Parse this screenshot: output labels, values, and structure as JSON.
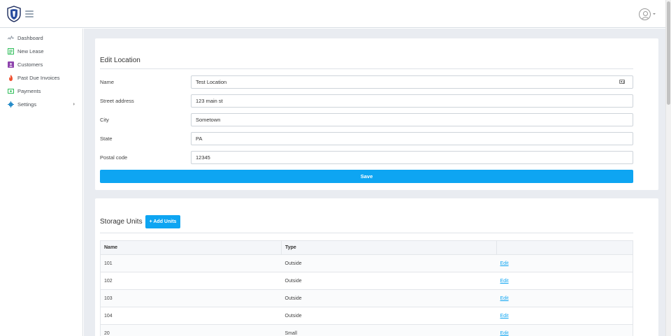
{
  "nav": {
    "items": [
      {
        "label": "Dashboard",
        "icon": "activity-icon",
        "color": "#8a94a0"
      },
      {
        "label": "New Lease",
        "icon": "document-icon",
        "color": "#2ebd59"
      },
      {
        "label": "Customers",
        "icon": "contact-card-icon",
        "color": "#8e44ad"
      },
      {
        "label": "Past Due Invoices",
        "icon": "flame-icon",
        "color": "#f0502f"
      },
      {
        "label": "Payments",
        "icon": "money-icon",
        "color": "#2ebd59"
      },
      {
        "label": "Settings",
        "icon": "gear-icon",
        "color": "#1e88c7"
      }
    ]
  },
  "edit_location": {
    "title": "Edit Location",
    "fields": [
      {
        "label": "Name",
        "value": "Test Location"
      },
      {
        "label": "Street address",
        "value": "123 main st"
      },
      {
        "label": "City",
        "value": "Sometown"
      },
      {
        "label": "State",
        "value": "PA"
      },
      {
        "label": "Postal code",
        "value": "12345"
      }
    ],
    "save_label": "Save"
  },
  "storage_units": {
    "title": "Storage Units",
    "add_label": "+ Add Units",
    "columns": [
      "Name",
      "Type",
      ""
    ],
    "rows": [
      {
        "name": "101",
        "type": "Outside",
        "action": "Edit"
      },
      {
        "name": "102",
        "type": "Outside",
        "action": "Edit"
      },
      {
        "name": "103",
        "type": "Outside",
        "action": "Edit"
      },
      {
        "name": "104",
        "type": "Outside",
        "action": "Edit"
      },
      {
        "name": "20",
        "type": "Small",
        "action": "Edit"
      }
    ]
  },
  "colors": {
    "accent": "#0ea5f2",
    "page_background": "#e9ecf1"
  }
}
